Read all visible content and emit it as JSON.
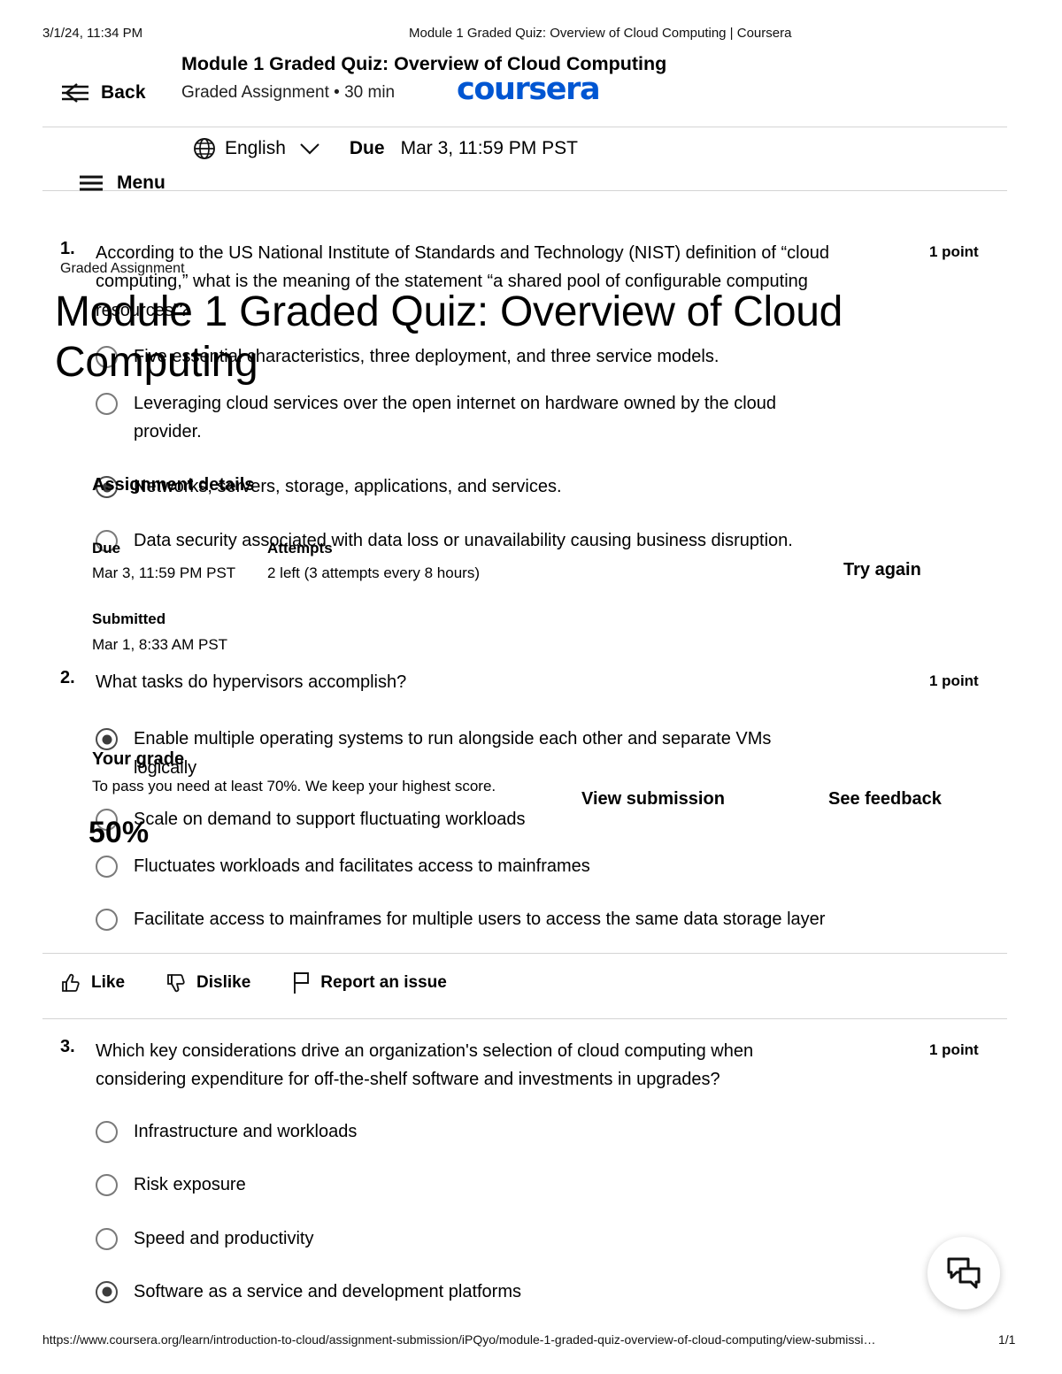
{
  "print": {
    "date": "3/1/24, 11:34 PM",
    "doc_title": "Module 1 Graded Quiz: Overview of Cloud Computing | Coursera",
    "url": "https://www.coursera.org/learn/introduction-to-cloud/assignment-submission/iPQyo/module-1-graded-quiz-overview-of-cloud-computing/view-submissi…",
    "page": "1/1"
  },
  "nav": {
    "back_label": "Back",
    "quiz_title": "Module 1 Graded Quiz: Overview of Cloud Computing",
    "quiz_subtitle": "Graded Assignment • 30 min",
    "logo_text": "coursera",
    "menu_label": "Menu"
  },
  "meta_bar": {
    "language": "English",
    "due_label": "Due",
    "due_value": "Mar 3, 11:59 PM PST"
  },
  "overlay": {
    "kicker": "Graded Assignment",
    "title": "Module 1 Graded Quiz: Overview of Cloud Computing",
    "details_heading": "Assignment details",
    "due_label": "Due",
    "due_value": "Mar 3, 11:59 PM PST",
    "attempts_label": "Attempts",
    "attempts_value": "2 left (3 attempts every 8 hours)",
    "try_again_label": "Try again",
    "submitted_label": "Submitted",
    "submitted_value": "Mar 1, 8:33 AM PST",
    "grade_label": "Your grade",
    "grade_note": "To pass you need at least 70%. We keep your highest score.",
    "grade_value": "50%",
    "view_submission_label": "View submission",
    "see_feedback_label": "See feedback"
  },
  "questions": [
    {
      "number": "1.",
      "text": "According to the US National Institute of Standards and Technology (NIST) definition of “cloud computing,” what is the meaning of the statement “a shared pool of configurable computing resources”?",
      "points": "1 point",
      "options": [
        {
          "label": "Five essential characteristics, three deployment, and three service models.",
          "selected": false
        },
        {
          "label": "Leveraging cloud services over the open internet on hardware owned by the cloud provider.",
          "selected": false
        },
        {
          "label": "Networks, servers, storage, applications, and services.",
          "selected": true
        },
        {
          "label": "Data security associated with data loss or unavailability causing business disruption.",
          "selected": false
        }
      ]
    },
    {
      "number": "2.",
      "text": "What tasks do hypervisors accomplish?",
      "points": "1 point",
      "options": [
        {
          "label": "Enable multiple operating systems to run alongside each other and separate VMs logically",
          "selected": true
        },
        {
          "label": "Scale on demand to support fluctuating workloads",
          "selected": false
        },
        {
          "label": "Fluctuates workloads and facilitates access to mainframes",
          "selected": false
        },
        {
          "label": "Facilitate access to mainframes for multiple users to access the same data storage layer",
          "selected": false
        }
      ]
    },
    {
      "number": "3.",
      "text": "Which key considerations drive an organization's selection of cloud computing when considering expenditure for off-the-shelf software and investments in upgrades?",
      "points": "1 point",
      "options": [
        {
          "label": "Infrastructure and workloads",
          "selected": false
        },
        {
          "label": "Risk exposure",
          "selected": false
        },
        {
          "label": "Speed and productivity",
          "selected": false
        },
        {
          "label": "Software as a service and development platforms",
          "selected": true
        }
      ]
    }
  ],
  "feedback_row": {
    "like_label": "Like",
    "dislike_label": "Dislike",
    "report_label": "Report an issue"
  },
  "colors": {
    "brand_blue": "#0056D2",
    "rule": "#d4d4d4",
    "radio_border": "#7a7a7a"
  }
}
